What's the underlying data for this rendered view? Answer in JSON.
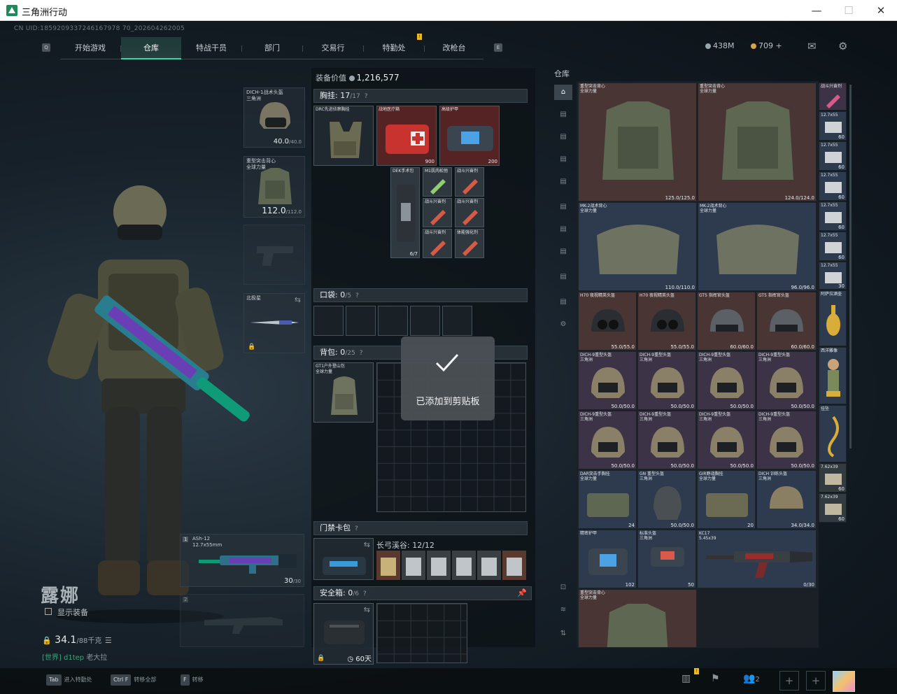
{
  "window": {
    "title": "三角洲行动",
    "min": "—",
    "max": "☐",
    "close": "✕"
  },
  "uid": "CN UID:1859209337246167978 70_202604262005",
  "nav": {
    "tabs": [
      {
        "label": "开始游戏"
      },
      {
        "label": "仓库"
      },
      {
        "label": "特战干员"
      },
      {
        "label": "部门"
      },
      {
        "label": "交易行"
      },
      {
        "label": "特勤处"
      },
      {
        "label": "改枪台"
      }
    ],
    "left_key": "Q",
    "right_key": "E",
    "notif": "!"
  },
  "currency": {
    "silver": "438M",
    "gold": "709",
    "plus": "+"
  },
  "equipment": {
    "helmet": {
      "name": "DICH-1战术头盔",
      "sub": "三角洲",
      "value": "40.0",
      "max": "/40.0"
    },
    "armor": {
      "name": "重型突击背心",
      "sub": "全球力量",
      "value": "112.0",
      "max": "/112.0"
    },
    "melee": {
      "name": "北极星"
    },
    "weapon1": {
      "slot": "1",
      "name": "ASh-12",
      "caliber": "12.7x55mm",
      "ammo": "30",
      "max": "/30"
    },
    "weapon2": {
      "slot": "2"
    }
  },
  "character": {
    "name": "露娜",
    "show_equip": "显示装备",
    "weight": "34.1",
    "weight_max": "/88千克",
    "tag": "[世界] d1tep",
    "tag_suffix": "老大拉"
  },
  "loadout": {
    "equip_value_label": "装备价值",
    "equip_value": "1,216,577",
    "chest": {
      "label": "胸挂:",
      "count": "17",
      "cap": "/17",
      "q": "?"
    },
    "chest_items": [
      {
        "name": "DRC先进侦察胸挂",
        "sub": "三角洲",
        "val": ""
      },
      {
        "name": "战地医疗箱",
        "val": "900"
      },
      {
        "name": "高级护甲",
        "val": "200"
      },
      {
        "name": "DEK手术包",
        "val": "6/7"
      },
      {
        "name": "M1肌肉松弛",
        "val": ""
      },
      {
        "name": "战斗兴奋剂",
        "val": ""
      },
      {
        "name": "战斗兴奋剂",
        "val": ""
      },
      {
        "name": "战斗兴奋剂",
        "val": ""
      },
      {
        "name": "战斗兴奋剂",
        "val": ""
      },
      {
        "name": "体能强化剂",
        "val": ""
      }
    ],
    "pocket": {
      "label": "口袋:",
      "count": "0",
      "cap": "/5",
      "q": "?"
    },
    "backpack": {
      "label": "背包:",
      "count": "0",
      "cap": "/25",
      "q": "?",
      "item": "GT1户外登山包",
      "item_sub": "全球力量"
    },
    "keycard": {
      "label": "门禁卡包",
      "q": "?",
      "sub": "长弓溪谷: 12/12"
    },
    "safebox": {
      "label": "安全箱:",
      "count": "0",
      "cap": "/6",
      "q": "?",
      "timer": "60天"
    }
  },
  "toast": {
    "message": "已添加到剪贴板"
  },
  "stash": {
    "title": "仓库",
    "items": [
      {
        "name": "重型突击背心",
        "sub": "全球力量",
        "val": "125.0/125.0"
      },
      {
        "name": "重型突击背心",
        "sub": "全球力量",
        "val": "124.0/124.0"
      },
      {
        "name": "MK-2战术背心",
        "sub": "全球力量",
        "val": "110.0/110.0"
      },
      {
        "name": "MK-2战术背心",
        "sub": "全球力量",
        "val": "96.0/96.0"
      },
      {
        "name": "H70 夜视精英头盔",
        "val": "55.0/55.0"
      },
      {
        "name": "H70 夜视精英头盔",
        "val": "55.0/55.0"
      },
      {
        "name": "GT5 指挥官头盔",
        "val": "60.0/60.0"
      },
      {
        "name": "GT5 指挥官头盔",
        "val": "60.0/60.0"
      },
      {
        "name": "DICH-9重型头盔",
        "sub": "三角洲",
        "val": "50.0/50.0"
      },
      {
        "name": "DICH-9重型头盔",
        "sub": "三角洲",
        "val": "50.0/50.0"
      },
      {
        "name": "DICH-9重型头盔",
        "sub": "三角洲",
        "val": "50.0/50.0"
      },
      {
        "name": "DICH-9重型头盔",
        "sub": "三角洲",
        "val": "50.0/50.0"
      },
      {
        "name": "DICH-9重型头盔",
        "sub": "三角洲",
        "val": "50.0/50.0"
      },
      {
        "name": "DICH-9重型头盔",
        "sub": "三角洲",
        "val": "50.0/50.0"
      },
      {
        "name": "DICH-9重型头盔",
        "sub": "三角洲",
        "val": "50.0/50.0"
      },
      {
        "name": "DICH-9重型头盔",
        "sub": "三角洲",
        "val": "50.0/50.0"
      },
      {
        "name": "DAR突击手胸挂",
        "sub": "全球力量",
        "val": "24"
      },
      {
        "name": "GN 重型头盔",
        "sub": "三角洲",
        "val": "50.0/50.0"
      },
      {
        "name": "GIR野战胸挂",
        "sub": "全球力量",
        "val": "20"
      },
      {
        "name": "DICH 训练头盔",
        "sub": "三角洲",
        "val": "34.0/34.0"
      },
      {
        "name": "精密护甲",
        "val": "102"
      },
      {
        "name": "标准头盔",
        "sub": "三角洲",
        "val": "50"
      },
      {
        "name": "KC17",
        "sub": "5.45x39",
        "val": "0/30"
      },
      {
        "name": "重型突击背心",
        "sub": "全球力量",
        "val": ""
      }
    ],
    "side_items": [
      {
        "name": "战斗兴奋剂",
        "val": ""
      },
      {
        "name": "12.7x55",
        "val": "60"
      },
      {
        "name": "12.7x55",
        "val": "60"
      },
      {
        "name": "12.7x55",
        "val": "60"
      },
      {
        "name": "12.7x55",
        "val": "60"
      },
      {
        "name": "12.7x55",
        "val": "60"
      },
      {
        "name": "12.7x55",
        "val": "30"
      },
      {
        "name": "阿萨拉酒壶",
        "val": ""
      },
      {
        "name": "西洋雕像",
        "val": ""
      },
      {
        "name": "挂坠",
        "val": ""
      },
      {
        "name": "7.62x39",
        "val": "60"
      },
      {
        "name": "7.62x39",
        "val": "60"
      }
    ]
  },
  "bottom": {
    "hints": [
      {
        "key": "Tab",
        "label": "进入特勤处"
      },
      {
        "key": "Ctrl F",
        "label": "转移全部"
      },
      {
        "key": "F",
        "label": "转移"
      }
    ],
    "squad": "2"
  },
  "colors": {
    "accent": "#36d6a1",
    "notif": "#e6b82a"
  }
}
